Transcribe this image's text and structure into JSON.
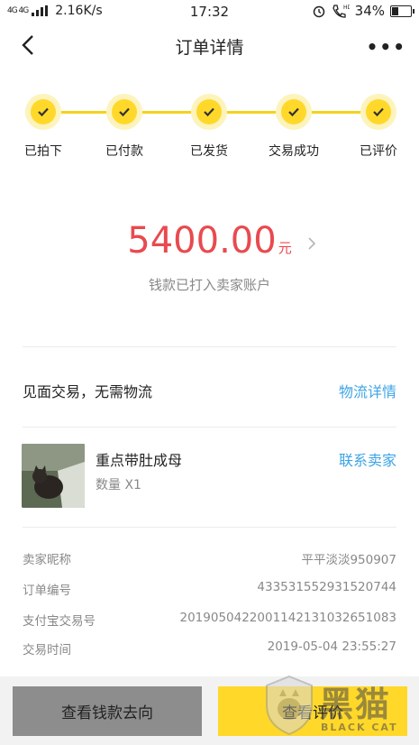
{
  "statusbar": {
    "network_type": "4G 4G",
    "speed": "2.16K/s",
    "time": "17:32",
    "battery": "34%",
    "battery_level": 0.34
  },
  "nav": {
    "title": "订单详情",
    "back_icon": "back-chevron-icon",
    "more_icon": "more-dots-icon"
  },
  "steps": [
    {
      "label": "已拍下",
      "done": true
    },
    {
      "label": "已付款",
      "done": true
    },
    {
      "label": "已发货",
      "done": true
    },
    {
      "label": "交易成功",
      "done": true
    },
    {
      "label": "已评价",
      "done": true
    }
  ],
  "amount": {
    "value": "5400.00",
    "unit": "元",
    "subtitle": "钱款已打入卖家账户"
  },
  "delivery": {
    "method": "见面交易，无需物流",
    "link": "物流详情"
  },
  "product": {
    "name": "重点带肚成母",
    "quantity": "数量 X1",
    "contact_link": "联系卖家"
  },
  "info": [
    {
      "label": "卖家昵称",
      "value": "平平淡淡950907"
    },
    {
      "label": "订单编号",
      "value": "433531552931520744"
    },
    {
      "label": "支付宝交易号",
      "value": "2019050422001142131032651083"
    },
    {
      "label": "交易时间",
      "value": "2019-05-04 23:55:27"
    }
  ],
  "buttons": {
    "view_funds": "查看钱款去向",
    "view_review": "查看评价"
  },
  "watermark": {
    "big": "黑猫",
    "small": "BLACK CAT"
  },
  "colors": {
    "accent_yellow": "#ffd82a",
    "price_red": "#e84a4f",
    "link_blue": "#3ea4e6"
  }
}
